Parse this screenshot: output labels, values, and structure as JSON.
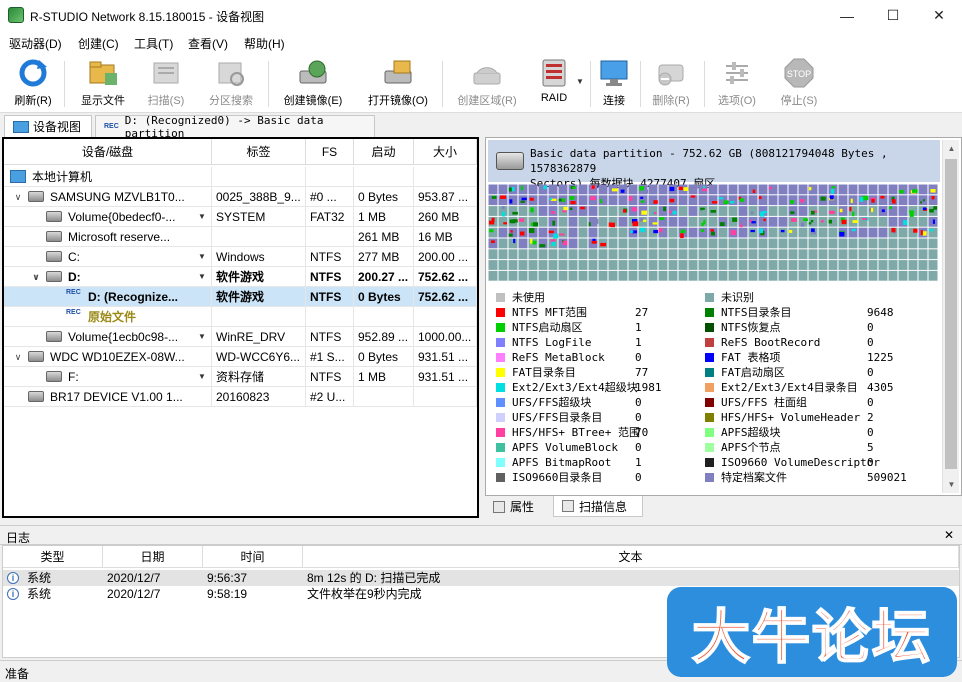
{
  "window": {
    "title": "R-STUDIO Network 8.15.180015 - 设备视图"
  },
  "menu": [
    "驱动器(D)",
    "创建(C)",
    "工具(T)",
    "查看(V)",
    "帮助(H)"
  ],
  "toolbar": [
    {
      "label": "刷新(R)",
      "icon": "refresh-icon",
      "enabled": true
    },
    {
      "label": "显示文件",
      "icon": "folder-icon",
      "enabled": true
    },
    {
      "label": "扫描(S)",
      "icon": "scan-icon",
      "enabled": false
    },
    {
      "label": "分区搜索",
      "icon": "partition-search-icon",
      "enabled": false
    },
    {
      "label": "创建镜像(E)",
      "icon": "create-image-icon",
      "enabled": true
    },
    {
      "label": "打开镜像(O)",
      "icon": "open-image-icon",
      "enabled": true
    },
    {
      "label": "创建区域(R)",
      "icon": "create-region-icon",
      "enabled": false
    },
    {
      "label": "RAID",
      "icon": "raid-icon",
      "enabled": true
    },
    {
      "label": "连接",
      "icon": "connect-icon",
      "enabled": true
    },
    {
      "label": "删除(R)",
      "icon": "delete-icon",
      "enabled": false
    },
    {
      "label": "选项(O)",
      "icon": "options-icon",
      "enabled": false
    },
    {
      "label": "停止(S)",
      "icon": "stop-icon",
      "enabled": false
    }
  ],
  "tabs": [
    {
      "label": "设备视图",
      "active": true
    },
    {
      "label": "D: (Recognized0) -> Basic data partition",
      "active": false
    }
  ],
  "device_table": {
    "headers": [
      "设备/磁盘",
      "标签",
      "FS",
      "启动",
      "大小"
    ],
    "rows": [
      {
        "name": "本地计算机",
        "label": "",
        "fs": "",
        "start": "",
        "size": "",
        "icon": "computer-icon",
        "bold": false,
        "selected": false
      },
      {
        "name": "SAMSUNG MZVLB1T0...",
        "label": "0025_388B_9...",
        "fs": "#0 ...",
        "start": "0 Bytes",
        "size": "953.87 ...",
        "icon": "disk-icon",
        "bold": false,
        "selected": false
      },
      {
        "name": "Volume{0bedecf0-...",
        "label": "SYSTEM",
        "fs": "FAT32",
        "start": "1 MB",
        "size": "260 MB",
        "icon": "drive-icon",
        "bold": false,
        "selected": false
      },
      {
        "name": "Microsoft reserve...",
        "label": "",
        "fs": "",
        "start": "261 MB",
        "size": "16 MB",
        "icon": "drive-icon",
        "bold": false,
        "selected": false
      },
      {
        "name": "C:",
        "label": "Windows",
        "fs": "NTFS",
        "start": "277 MB",
        "size": "200.00 ...",
        "icon": "drive-icon",
        "bold": false,
        "selected": false
      },
      {
        "name": "D:",
        "label": "软件游戏",
        "fs": "NTFS",
        "start": "200.27 ...",
        "size": "752.62 ...",
        "icon": "drive-icon",
        "bold": true,
        "selected": false
      },
      {
        "name": "D: (Recognize...",
        "label": "软件游戏",
        "fs": "NTFS",
        "start": "0 Bytes",
        "size": "752.62 ...",
        "icon": "recognized-icon",
        "bold": true,
        "selected": true
      },
      {
        "name": "原始文件",
        "label": "",
        "fs": "",
        "start": "",
        "size": "",
        "icon": "recognized-icon",
        "bold": true,
        "selected": false
      },
      {
        "name": "Volume{1ecb0c98-...",
        "label": "WinRE_DRV",
        "fs": "NTFS",
        "start": "952.89 ...",
        "size": "1000.00...",
        "icon": "drive-icon",
        "bold": false,
        "selected": false
      },
      {
        "name": "WDC WD10EZEX-08W...",
        "label": "WD-WCC6Y6...",
        "fs": "#1 S...",
        "start": "0 Bytes",
        "size": "931.51 ...",
        "icon": "disk-icon",
        "bold": false,
        "selected": false
      },
      {
        "name": "F:",
        "label": "资料存储",
        "fs": "NTFS",
        "start": "1 MB",
        "size": "931.51 ...",
        "icon": "drive-icon",
        "bold": false,
        "selected": false
      },
      {
        "name": "BR17 DEVICE V1.00 1...",
        "label": "20160823",
        "fs": "#2 U...",
        "start": "",
        "size": "",
        "icon": "drive-icon",
        "bold": false,
        "selected": false
      }
    ]
  },
  "scan_panel": {
    "header_line1": "Basic data partition - 752.62 GB (808121794048 Bytes , 1578362879",
    "header_line2": "Sectors) 每数据块 4277407 扇区",
    "legend": [
      {
        "name": "未使用",
        "count": "",
        "color": "#c0c0c0"
      },
      {
        "name": "未识别",
        "count": "",
        "color": "#7fa8a8"
      },
      {
        "name": "NTFS MFT范围",
        "count": "27",
        "color": "#ff0000"
      },
      {
        "name": "NTFS目录条目",
        "count": "9648",
        "color": "#008000"
      },
      {
        "name": "NTFS启动扇区",
        "count": "1",
        "color": "#00d000"
      },
      {
        "name": "NTFS恢复点",
        "count": "0",
        "color": "#005000"
      },
      {
        "name": "NTFS LogFile",
        "count": "1",
        "color": "#8080ff"
      },
      {
        "name": "ReFS BootRecord",
        "count": "0",
        "color": "#c04040"
      },
      {
        "name": "ReFS MetaBlock",
        "count": "0",
        "color": "#ff80ff"
      },
      {
        "name": "FAT 表格项",
        "count": "1225",
        "color": "#0000ff"
      },
      {
        "name": "FAT目录条目",
        "count": "77",
        "color": "#ffff00"
      },
      {
        "name": "FAT启动扇区",
        "count": "0",
        "color": "#008080"
      },
      {
        "name": "Ext2/Ext3/Ext4超级块",
        "count": "1981",
        "color": "#00e0e0"
      },
      {
        "name": "Ext2/Ext3/Ext4目录条目",
        "count": "4305",
        "color": "#f0a060"
      },
      {
        "name": "UFS/FFS超级块",
        "count": "0",
        "color": "#6090ff"
      },
      {
        "name": "UFS/FFS 柱面组",
        "count": "0",
        "color": "#800000"
      },
      {
        "name": "UFS/FFS目录条目",
        "count": "0",
        "color": "#d0d0ff"
      },
      {
        "name": "HFS/HFS+ VolumeHeader",
        "count": "2",
        "color": "#808000"
      },
      {
        "name": "HFS/HFS+ BTree+ 范围",
        "count": "70",
        "color": "#ff40a0"
      },
      {
        "name": "APFS超级块",
        "count": "0",
        "color": "#80ff80"
      },
      {
        "name": "APFS VolumeBlock",
        "count": "0",
        "color": "#40c0a0"
      },
      {
        "name": "APFS个节点",
        "count": "5",
        "color": "#a0ffa0"
      },
      {
        "name": "APFS BitmapRoot",
        "count": "1",
        "color": "#80ffff"
      },
      {
        "name": "ISO9660 VolumeDescriptor",
        "count": "0",
        "color": "#202020"
      },
      {
        "name": "ISO9660目录条目",
        "count": "0",
        "color": "#606060"
      },
      {
        "name": "特定档案文件",
        "count": "509021",
        "color": "#8080c0"
      }
    ],
    "bottom_tabs": [
      {
        "label": "属性",
        "active": false
      },
      {
        "label": "扫描信息",
        "active": true
      }
    ]
  },
  "log": {
    "title": "日志",
    "headers": [
      "类型",
      "日期",
      "时间",
      "文本"
    ],
    "rows": [
      {
        "type": "系统",
        "date": "2020/12/7",
        "time": "9:56:37",
        "text": "8m 12s 的 D: 扫描已完成"
      },
      {
        "type": "系统",
        "date": "2020/12/7",
        "time": "9:58:19",
        "text": "文件枚举在9秒内完成"
      }
    ]
  },
  "status": "准备",
  "watermark": "大牛论坛",
  "colors": {
    "accent": "#0078d7",
    "selection": "#cce4f7",
    "watermark_bg": "#2e8ede",
    "watermark_text": "#e8522f"
  }
}
